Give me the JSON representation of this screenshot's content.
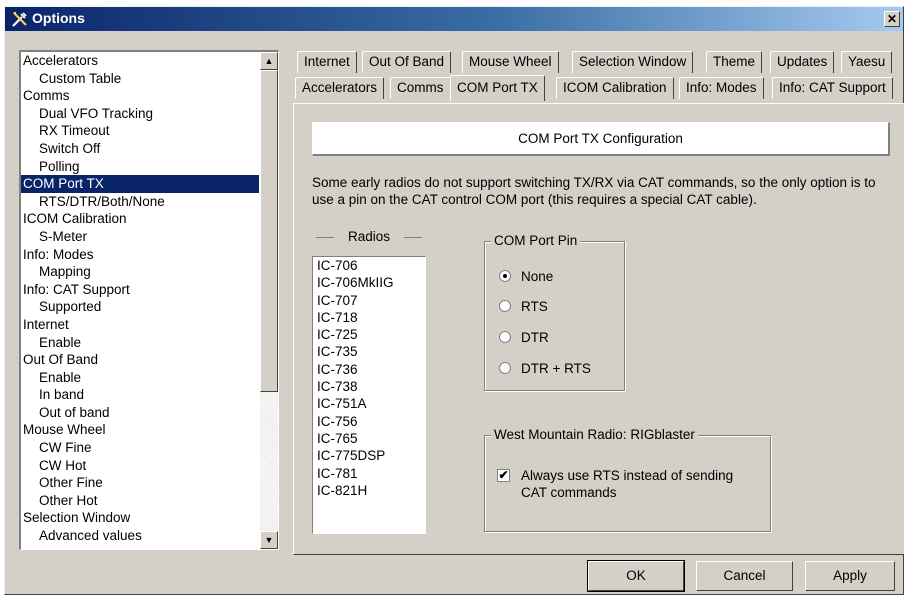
{
  "window": {
    "title": "Options",
    "close_label": "✕"
  },
  "tree": {
    "items": [
      {
        "label": "Accelerators",
        "child": false
      },
      {
        "label": "Custom Table",
        "child": true
      },
      {
        "label": "Comms",
        "child": false
      },
      {
        "label": "Dual VFO Tracking",
        "child": true
      },
      {
        "label": "RX Timeout",
        "child": true
      },
      {
        "label": "Switch Off",
        "child": true
      },
      {
        "label": "Polling",
        "child": true
      },
      {
        "label": "COM Port TX",
        "child": false,
        "selected": true
      },
      {
        "label": "RTS/DTR/Both/None",
        "child": true
      },
      {
        "label": "ICOM Calibration",
        "child": false
      },
      {
        "label": "S-Meter",
        "child": true
      },
      {
        "label": "Info: Modes",
        "child": false
      },
      {
        "label": "Mapping",
        "child": true
      },
      {
        "label": "Info: CAT Support",
        "child": false
      },
      {
        "label": "Supported",
        "child": true
      },
      {
        "label": "Internet",
        "child": false
      },
      {
        "label": "Enable",
        "child": true
      },
      {
        "label": "Out Of Band",
        "child": false
      },
      {
        "label": "Enable",
        "child": true
      },
      {
        "label": "In band",
        "child": true
      },
      {
        "label": "Out of band",
        "child": true
      },
      {
        "label": "Mouse Wheel",
        "child": false
      },
      {
        "label": "CW Fine",
        "child": true
      },
      {
        "label": "CW Hot",
        "child": true
      },
      {
        "label": "Other Fine",
        "child": true
      },
      {
        "label": "Other Hot",
        "child": true
      },
      {
        "label": "Selection Window",
        "child": false
      },
      {
        "label": "Advanced values",
        "child": true
      }
    ]
  },
  "tabs": {
    "row1": [
      "Internet",
      "Out Of Band",
      "Mouse Wheel",
      "Selection Window",
      "Theme",
      "Updates",
      "Yaesu"
    ],
    "row2": [
      "Accelerators",
      "Comms",
      "COM Port TX",
      "ICOM Calibration",
      "Info: Modes",
      "Info: CAT Support"
    ],
    "active": "COM Port TX"
  },
  "panel": {
    "heading": "COM Port TX Configuration",
    "description": "Some early radios do not support switching TX/RX via CAT commands, so the only option is to use a pin on the CAT control COM port (this requires a special CAT cable).",
    "radios_label": "Radios",
    "radios": [
      "IC-706",
      "IC-706MkIIG",
      "IC-707",
      "IC-718",
      "IC-725",
      "IC-735",
      "IC-736",
      "IC-738",
      "IC-751A",
      "IC-756",
      "IC-765",
      "IC-775DSP",
      "IC-781",
      "IC-821H"
    ],
    "com_port_pin": {
      "title": "COM Port Pin",
      "options": [
        "None",
        "RTS",
        "DTR",
        "DTR + RTS"
      ],
      "selected": "None"
    },
    "rigblaster": {
      "title": "West Mountain Radio: RIGblaster",
      "checkbox_label": "Always use RTS instead of sending CAT commands",
      "checked": true
    }
  },
  "buttons": {
    "ok": "OK",
    "cancel": "Cancel",
    "apply": "Apply"
  }
}
